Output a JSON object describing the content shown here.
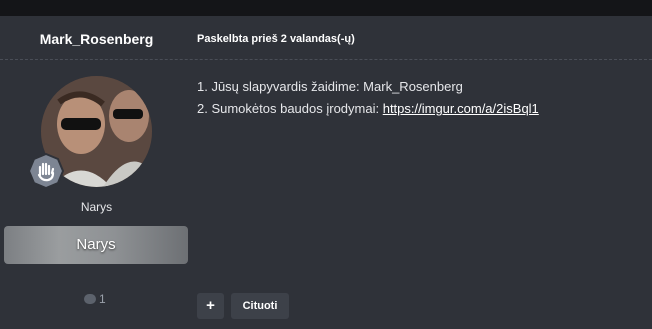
{
  "post": {
    "author": "Mark_Rosenberg",
    "meta": "Paskelbta prieš 2 valandas(-ų)",
    "role": "Narys",
    "role_banner": "Narys",
    "comment_count": "1",
    "lines": [
      {
        "text": "1. Jūsų slapyvardis žaidime: Mark_Rosenberg"
      },
      {
        "prefix": "2. Sumokėtos baudos įrodymai: ",
        "link": "https://imgur.com/a/2isBql1"
      }
    ],
    "buttons": {
      "add": "+",
      "quote": "Cituoti"
    }
  },
  "icons": {
    "rank": "waving-hand-badge-icon",
    "comment": "comment-bubble-icon"
  },
  "colors": {
    "background": "#2f3239",
    "topbar": "#141518",
    "text": "#e6e7ea"
  }
}
